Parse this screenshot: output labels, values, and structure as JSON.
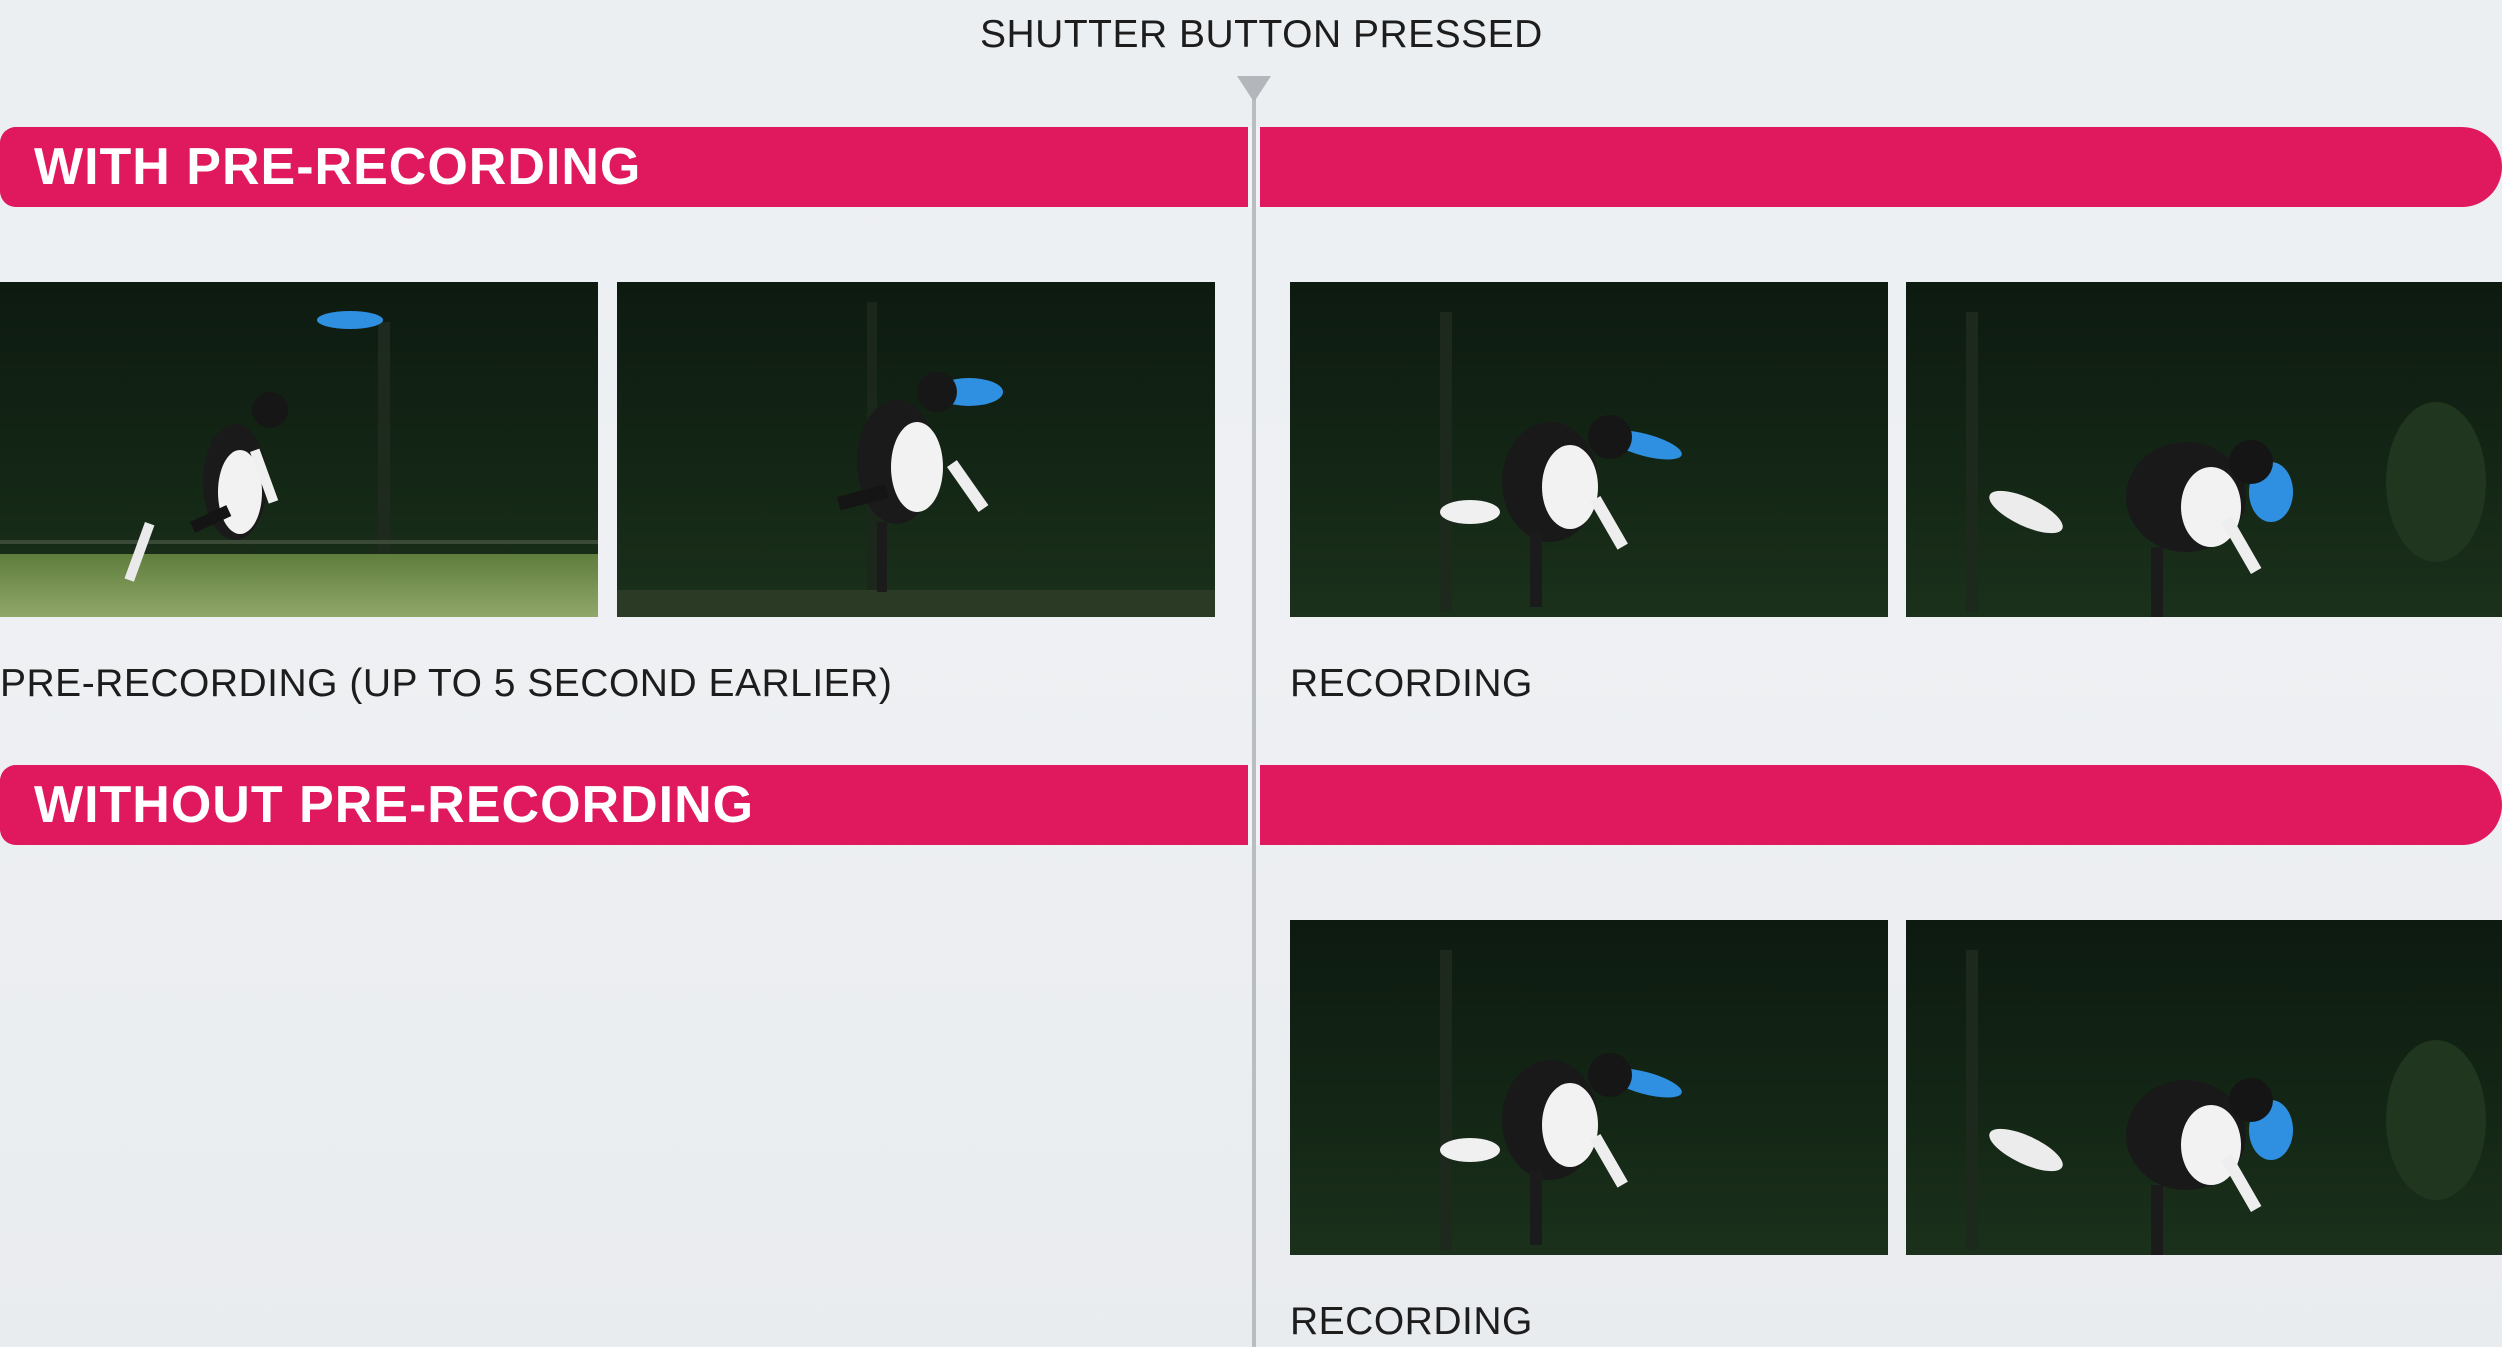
{
  "header": {
    "shutter_label": "SHUTTER BUTTON PRESSED"
  },
  "sections": {
    "with": {
      "banner": "WITH PRE-RECORDING",
      "prerecording_caption": "PRE-RECORDING (UP TO 5 SECOND EARLIER)",
      "recording_caption": "RECORDING"
    },
    "without": {
      "banner": "WITHOUT PRE-RECORDING",
      "recording_caption": "RECORDING"
    }
  },
  "colors": {
    "banner": "#e0195f",
    "timeline": "#b9bcc0",
    "frisbee": "#2f8fe0"
  },
  "photo_subjects": [
    "border-collie-jumping-for-frisbee",
    "border-collie-catching-frisbee",
    "border-collie-holding-frisbee",
    "border-collie-landing-with-frisbee"
  ]
}
